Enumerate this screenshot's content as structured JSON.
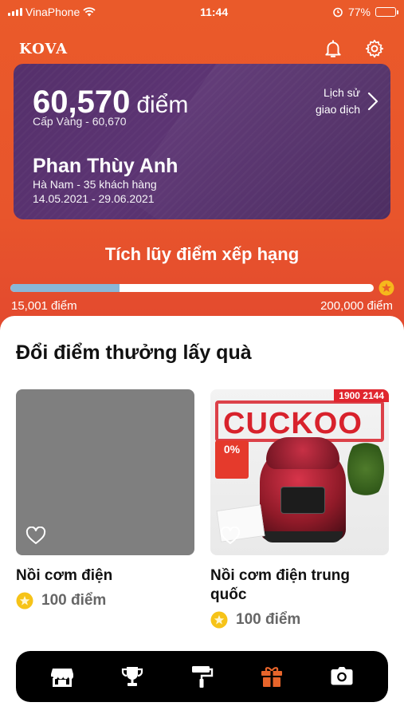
{
  "status_bar": {
    "carrier": "VinaPhone",
    "time": "11:44",
    "battery": "77%"
  },
  "header": {
    "brand": "KOVA",
    "icons": [
      "bell-icon",
      "gear-icon"
    ]
  },
  "card": {
    "points_value": "60,570",
    "points_unit": "điểm",
    "tier": "Cấp Vàng - 60,670",
    "history_line1": "Lịch sử",
    "history_line2": "giao dịch",
    "user_name": "Phan Thùy Anh",
    "user_location": "Hà Nam - 35 khách hàng",
    "user_period": "14.05.2021 - 29.06.2021",
    "colors": {
      "card": "#55306b",
      "background": "#e8552c"
    }
  },
  "ranking": {
    "title": "Tích lũy điểm xếp hạng",
    "progress_fraction": 0.3,
    "label_min": "15,001 điểm",
    "label_max": "200,000 điểm"
  },
  "rewards": {
    "title": "Đổi điểm thưởng lấy quà",
    "products": [
      {
        "name": "Nồi cơm điện",
        "points": "100 điểm",
        "favorited": false
      },
      {
        "name": "Nồi cơm điện trung quốc",
        "points": "100 điểm",
        "favorited": false
      }
    ],
    "product2_image_text": {
      "banner": "1900 2144",
      "brand": "CUCKOO",
      "promo": "0%"
    }
  },
  "bottom_nav": {
    "items": [
      "store-icon",
      "trophy-icon",
      "paint-roller-icon",
      "gift-icon",
      "camera-icon"
    ],
    "active": "gift-icon",
    "active_color": "#e8652b"
  }
}
